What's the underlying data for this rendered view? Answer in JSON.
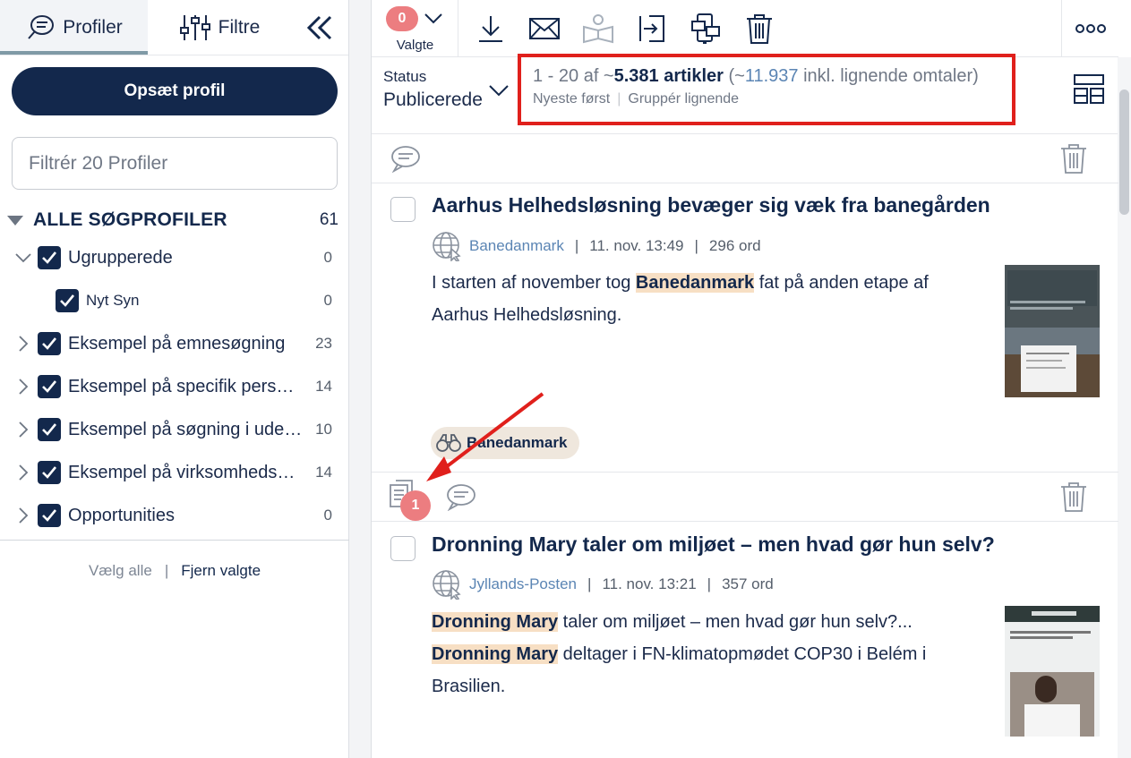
{
  "sidebar": {
    "tabs": [
      {
        "label": "Profiler",
        "icon": "chat-search-icon"
      },
      {
        "label": "Filtre",
        "icon": "sliders-icon"
      }
    ],
    "setup_button": "Opsæt profil",
    "filter_placeholder": "Filtrér 20 Profiler",
    "all_profiles": {
      "label": "ALLE SØGPROFILER",
      "count": "61"
    },
    "profiles": [
      {
        "label": "Ugrupperede",
        "count": "0",
        "expanded": true
      },
      {
        "label": "Nyt Syn",
        "count": "0",
        "child": true
      },
      {
        "label": "Eksempel på emnesøgning",
        "count": "23"
      },
      {
        "label": "Eksempel på specifik pers…",
        "count": "14"
      },
      {
        "label": "Eksempel på søgning i ude…",
        "count": "10"
      },
      {
        "label": "Eksempel på virksomheds…",
        "count": "14"
      },
      {
        "label": "Opportunities",
        "count": "0"
      }
    ],
    "footer": {
      "select_all": "Vælg alle",
      "separator": "|",
      "deselect": "Fjern valgte"
    }
  },
  "toolbar": {
    "selected_count": "0",
    "selected_label": "Valgte",
    "icons": [
      "download-icon",
      "mail-icon",
      "read-icon",
      "export-icon",
      "share-devices-icon",
      "trash-icon"
    ],
    "more_icon": "more-icon"
  },
  "status": {
    "label": "Status",
    "value": "Publicerede",
    "range": "1 - 20 af ~",
    "articles": "5.381 artikler",
    "open_paren": " (~",
    "similar_count": "11.937",
    "similar_text": " inkl. lignende omtaler)",
    "sort": "Nyeste først",
    "separator": "|",
    "group": "Gruppér lignende"
  },
  "articles": [
    {
      "title": "Aarhus Helhedsløsning bevæger sig væk fra banegården",
      "source": "Banedanmark",
      "date": "11. nov. 13:49",
      "words": "296 ord",
      "meta_sep": "|",
      "snippet": [
        {
          "text": "I starten af november tog ",
          "hl": false
        },
        {
          "text": "Banedanmark",
          "hl": true
        },
        {
          "text": " fat på anden etape af Aarhus Helhedsløsning.",
          "hl": false
        }
      ],
      "tag": "Banedanmark",
      "duplicates": "1"
    },
    {
      "title": "Dronning Mary taler om miljøet – men hvad gør hun selv?",
      "source": "Jyllands-Posten",
      "date": "11. nov. 13:21",
      "words": "357 ord",
      "meta_sep": "|",
      "snippet": [
        {
          "text": "Dronning Mary",
          "hl": true
        },
        {
          "text": " taler om miljøet – men hvad gør hun selv?... ",
          "hl": false
        },
        {
          "text": "Dronning Mary",
          "hl": true
        },
        {
          "text": " deltager i FN-klimatopmødet COP30 i Belém i Brasilien.",
          "hl": false
        }
      ]
    }
  ],
  "colors": {
    "navy": "#13284c",
    "badge": "#ec7d80",
    "highlight": "#f7dfc4",
    "link": "#5b85b4",
    "annotation": "#e0201c"
  }
}
